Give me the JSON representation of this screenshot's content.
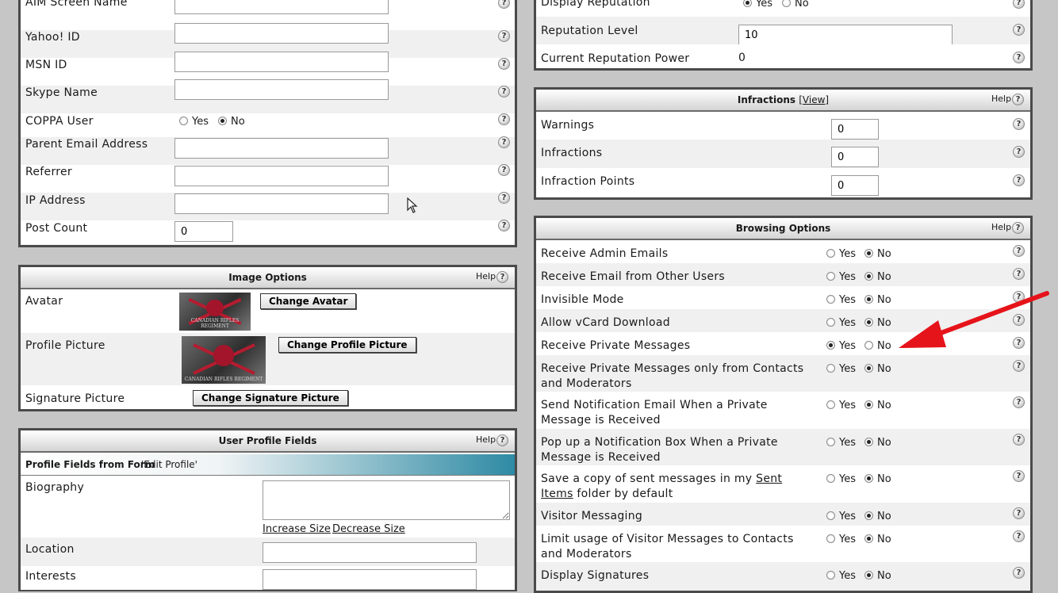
{
  "left_profile": {
    "rows": [
      {
        "label": "AIM Screen Name",
        "value": ""
      },
      {
        "label": "Yahoo! ID",
        "value": ""
      },
      {
        "label": "MSN ID",
        "value": ""
      },
      {
        "label": "Skype Name",
        "value": ""
      },
      {
        "label": "COPPA User",
        "yes": "Yes",
        "no": "No"
      },
      {
        "label": "Parent Email Address",
        "value": ""
      },
      {
        "label": "Referrer",
        "value": ""
      },
      {
        "label": "IP Address",
        "value": ""
      },
      {
        "label": "Post Count",
        "value": "0"
      }
    ]
  },
  "image_options": {
    "title": "Image Options",
    "help": "Help",
    "avatar_label": "Avatar",
    "avatar_button": "Change Avatar",
    "profile_picture_label": "Profile Picture",
    "profile_picture_button": "Change Profile Picture",
    "signature_label": "Signature Picture",
    "signature_button": "Change Signature Picture",
    "image_text": "CANADIAN RIFLES REGIMENT"
  },
  "user_profile_fields": {
    "title": "User Profile Fields",
    "help": "Help",
    "subheader_prefix": "Profile Fields from Form ",
    "subheader_form": "'Edit Profile'",
    "biography_label": "Biography",
    "increase": "Increase Size",
    "decrease": "Decrease Size",
    "location_label": "Location",
    "interests_label": "Interests"
  },
  "reputation": {
    "display_label": "Display Reputation",
    "yes": "Yes",
    "no": "No",
    "level_label": "Reputation Level",
    "level_value": "10",
    "power_label": "Current Reputation Power",
    "power_value": "0"
  },
  "infractions": {
    "title": "Infractions",
    "view": "[View]",
    "help": "Help",
    "rows": [
      {
        "label": "Warnings",
        "value": "0"
      },
      {
        "label": "Infractions",
        "value": "0"
      },
      {
        "label": "Infraction Points",
        "value": "0"
      }
    ]
  },
  "browsing": {
    "title": "Browsing Options",
    "help": "Help",
    "yes": "Yes",
    "no": "No",
    "rows": [
      {
        "l1": "Receive Admin Emails",
        "l2": "",
        "selected": "no"
      },
      {
        "l1": "Receive Email from Other Users",
        "l2": "",
        "selected": "no"
      },
      {
        "l1": "Invisible Mode",
        "l2": "",
        "selected": "no"
      },
      {
        "l1": "Allow vCard Download",
        "l2": "",
        "selected": "no"
      },
      {
        "l1": "Receive Private Messages",
        "l2": "",
        "selected": "yes"
      },
      {
        "l1": "Receive Private Messages only from Contacts",
        "l2": "and Moderators",
        "selected": "no"
      },
      {
        "l1": "Send Notification Email When a Private",
        "l2": "Message is Received",
        "selected": "no"
      },
      {
        "l1": "Pop up a Notification Box When a Private",
        "l2": "Message is Received",
        "selected": "no"
      },
      {
        "l1a": "Save a copy of sent messages in my ",
        "l1link": "Sent",
        "l2link": "Items",
        "l2b": " folder by default",
        "selected": "no"
      },
      {
        "l1": "Visitor Messaging",
        "l2": "",
        "selected": "no"
      },
      {
        "l1": "Limit usage of Visitor Messages to Contacts",
        "l2": "and Moderators",
        "selected": "no"
      },
      {
        "l1": "Display Signatures",
        "l2": "",
        "selected": "no"
      }
    ]
  },
  "colors": {
    "arrow": "#e5141a",
    "subheader_start": "#ffffff",
    "subheader_end": "#2e8aa3"
  }
}
